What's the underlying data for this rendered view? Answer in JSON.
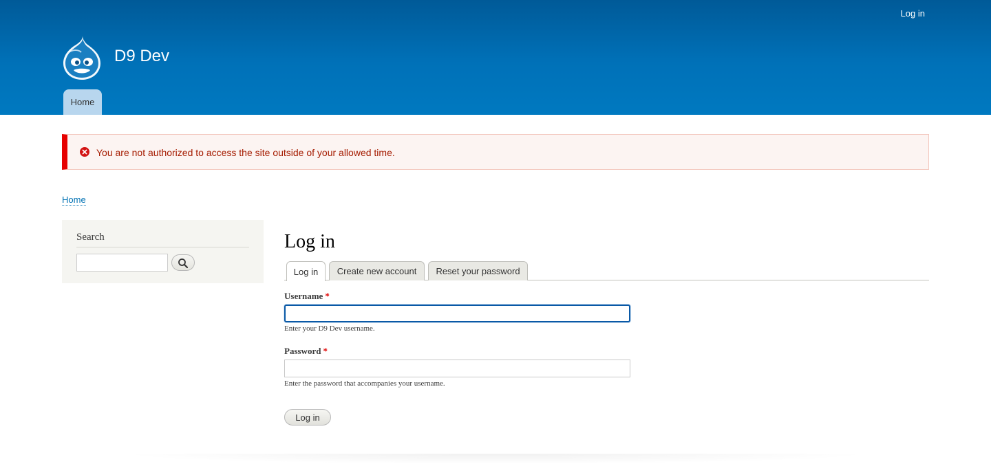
{
  "header": {
    "secondary_menu": {
      "login_link": "Log in"
    },
    "site_name": "D9 Dev",
    "logo_icon": "drupal-drop-icon",
    "main_menu": {
      "items": [
        {
          "label": "Home",
          "active": true
        }
      ]
    },
    "colors": {
      "gradient_top": "#005a98",
      "gradient_bottom": "#0079c0",
      "active_tab": "#b8d6ee"
    }
  },
  "messages": {
    "error": {
      "icon": "error-circle-x-icon",
      "text": "You are not authorized to access the site outside of your allowed time.",
      "colors": {
        "border_left": "#e60000",
        "background": "#fcf4f2",
        "text": "#a51b00"
      }
    }
  },
  "breadcrumb": {
    "items": [
      "Home"
    ]
  },
  "sidebar": {
    "search_block": {
      "title": "Search",
      "input_value": "",
      "button_icon": "magnifier-icon"
    }
  },
  "main": {
    "title": "Log in",
    "tabs": [
      {
        "label": "Log in",
        "active": true
      },
      {
        "label": "Create new account",
        "active": false
      },
      {
        "label": "Reset your password",
        "active": false
      }
    ],
    "form": {
      "username": {
        "label": "Username",
        "required_mark": "*",
        "value": "",
        "description": "Enter your D9 Dev username."
      },
      "password": {
        "label": "Password",
        "required_mark": "*",
        "value": "",
        "description": "Enter the password that accompanies your username."
      },
      "submit_label": "Log in"
    }
  }
}
